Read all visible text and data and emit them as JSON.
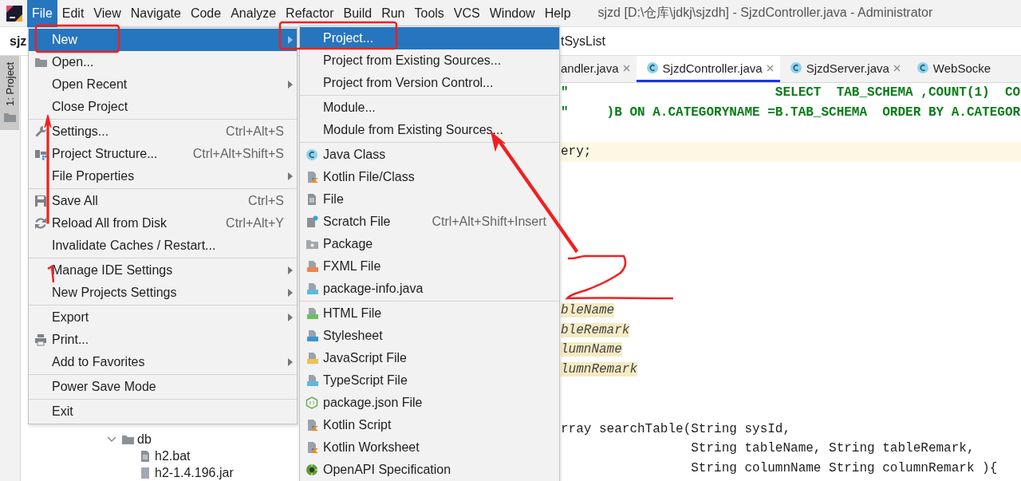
{
  "window": {
    "title": "sjzd [D:\\仓库\\jdkj\\sjzdh] - SjzdController.java - Administrator"
  },
  "menu_bar": [
    {
      "label": "File",
      "selected": true
    },
    {
      "label": "Edit",
      "selected": false
    },
    {
      "label": "View",
      "selected": false
    },
    {
      "label": "Navigate",
      "selected": false
    },
    {
      "label": "Code",
      "selected": false
    },
    {
      "label": "Analyze",
      "selected": false
    },
    {
      "label": "Refactor",
      "selected": false
    },
    {
      "label": "Build",
      "selected": false
    },
    {
      "label": "Run",
      "selected": false
    },
    {
      "label": "Tools",
      "selected": false
    },
    {
      "label": "VCS",
      "selected": false
    },
    {
      "label": "Window",
      "selected": false
    },
    {
      "label": "Help",
      "selected": false
    }
  ],
  "navigation_bar": [
    "sjz",
    "tSysList"
  ],
  "tool_window_tab": {
    "label": "1: Project",
    "selected": true
  },
  "project_tree": [
    {
      "label": "db",
      "expanded": true,
      "children": [
        {
          "label": "h2.bat"
        },
        {
          "label": "h2-1.4.196.jar"
        }
      ]
    }
  ],
  "editor_tabs": [
    {
      "label": "andler.java",
      "selected": false
    },
    {
      "label": "SjzdController.java",
      "selected": true
    },
    {
      "label": "SjzdServer.java",
      "selected": false
    },
    {
      "label": "WebSocke",
      "selected": false
    }
  ],
  "code_lines": [
    {
      "kind": "string",
      "text": "\"                           SELECT  TAB_SCHEMA ,COUNT(1)  CO"
    },
    {
      "kind": "string",
      "text": "\"     )B ON A.CATEGORYNAME =B.TAB_SCHEMA  ORDER BY A.CATEGOR"
    },
    {
      "kind": "blank"
    },
    {
      "kind": "current",
      "text": "ery;"
    },
    {
      "kind": "blank"
    },
    {
      "kind": "blank"
    },
    {
      "kind": "blank"
    },
    {
      "kind": "blank"
    },
    {
      "kind": "blank"
    },
    {
      "kind": "blank"
    },
    {
      "kind": "blank"
    },
    {
      "kind": "field",
      "text": "bleName"
    },
    {
      "kind": "field",
      "text": "bleRemark"
    },
    {
      "kind": "field",
      "text": "lumnName"
    },
    {
      "kind": "field",
      "text": "lumnRemark"
    },
    {
      "kind": "blank"
    },
    {
      "kind": "blank"
    },
    {
      "kind": "code",
      "text": "rray searchTable(String sysId,"
    },
    {
      "kind": "code",
      "text": "                 String tableName, String tableRemark,"
    },
    {
      "kind": "code",
      "text": "                 String columnName String columnRemark ){"
    }
  ],
  "file_menu": [
    [
      {
        "label": "New",
        "selected": true,
        "submenu": true
      },
      {
        "label": "Open...",
        "selected": false,
        "submenu": false
      },
      {
        "label": "Open Recent",
        "selected": false,
        "submenu": true
      },
      {
        "label": "Close Project",
        "selected": false,
        "submenu": false
      }
    ],
    [
      {
        "label": "Settings...",
        "selected": false,
        "submenu": false,
        "shortcut": "Ctrl+Alt+S"
      },
      {
        "label": "Project Structure...",
        "selected": false,
        "submenu": false,
        "shortcut": "Ctrl+Alt+Shift+S"
      },
      {
        "label": "File Properties",
        "selected": false,
        "submenu": true
      }
    ],
    [
      {
        "label": "Save All",
        "selected": false,
        "submenu": false,
        "shortcut": "Ctrl+S"
      },
      {
        "label": "Reload All from Disk",
        "selected": false,
        "submenu": false,
        "shortcut": "Ctrl+Alt+Y"
      },
      {
        "label": "Invalidate Caches / Restart...",
        "selected": false,
        "submenu": false
      }
    ],
    [
      {
        "label": "Manage IDE Settings",
        "selected": false,
        "submenu": true
      },
      {
        "label": "New Projects Settings",
        "selected": false,
        "submenu": true
      }
    ],
    [
      {
        "label": "Export",
        "selected": false,
        "submenu": true
      },
      {
        "label": "Print...",
        "selected": false,
        "submenu": false
      },
      {
        "label": "Add to Favorites",
        "selected": false,
        "submenu": true
      }
    ],
    [
      {
        "label": "Power Save Mode",
        "selected": false,
        "submenu": false
      }
    ],
    [
      {
        "label": "Exit",
        "selected": false,
        "submenu": false
      }
    ]
  ],
  "new_submenu": [
    [
      {
        "label": "Project...",
        "selected": true,
        "submenu": false
      },
      {
        "label": "Project from Existing Sources...",
        "selected": false,
        "submenu": false
      },
      {
        "label": "Project from Version Control...",
        "selected": false,
        "submenu": false
      }
    ],
    [
      {
        "label": "Module...",
        "selected": false,
        "submenu": false
      },
      {
        "label": "Module from Existing Sources...",
        "selected": false,
        "submenu": false
      }
    ],
    [
      {
        "label": "Java Class",
        "selected": false,
        "submenu": false
      },
      {
        "label": "Kotlin File/Class",
        "selected": false,
        "submenu": false
      },
      {
        "label": "File",
        "selected": false,
        "submenu": false
      },
      {
        "label": "Scratch File",
        "selected": false,
        "submenu": false,
        "shortcut": "Ctrl+Alt+Shift+Insert"
      },
      {
        "label": "Package",
        "selected": false,
        "submenu": false
      },
      {
        "label": "FXML File",
        "selected": false,
        "submenu": false
      },
      {
        "label": "package-info.java",
        "selected": false,
        "submenu": false
      }
    ],
    [
      {
        "label": "HTML File",
        "selected": false,
        "submenu": false
      },
      {
        "label": "Stylesheet",
        "selected": false,
        "submenu": false
      },
      {
        "label": "JavaScript File",
        "selected": false,
        "submenu": false
      },
      {
        "label": "TypeScript File",
        "selected": false,
        "submenu": false
      },
      {
        "label": "package.json File",
        "selected": false,
        "submenu": false
      },
      {
        "label": "Kotlin Script",
        "selected": false,
        "submenu": false
      },
      {
        "label": "Kotlin Worksheet",
        "selected": false,
        "submenu": false
      },
      {
        "label": "OpenAPI Specification",
        "selected": false,
        "submenu": false
      }
    ]
  ]
}
